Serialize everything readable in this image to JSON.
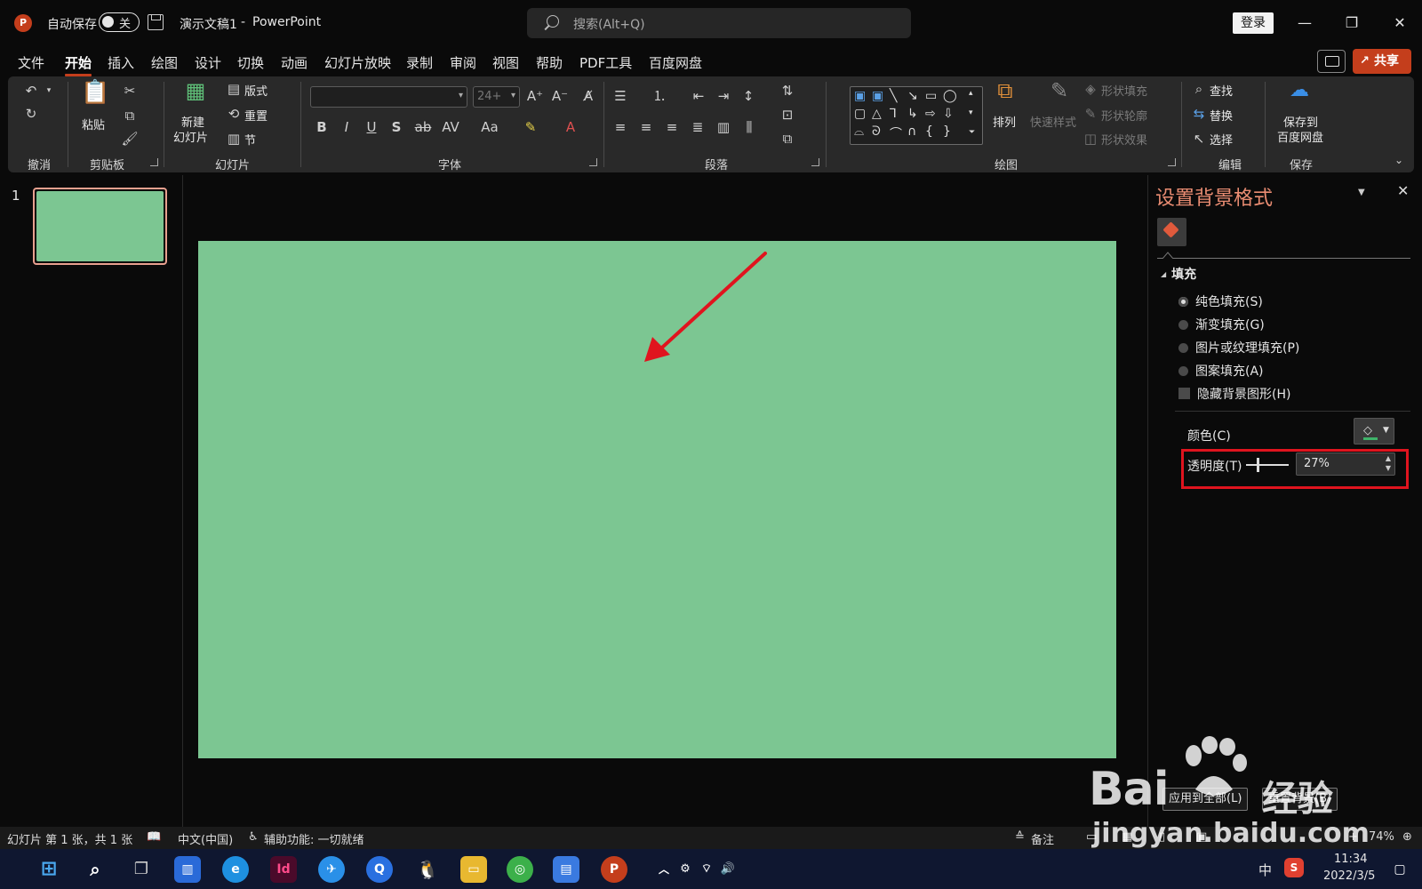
{
  "titlebar": {
    "logo": "P",
    "autosave_label": "自动保存",
    "autosave_state": "关",
    "doc_title": "演示文稿1",
    "separator": "-",
    "app_name": "PowerPoint",
    "search_placeholder": "搜索(Alt+Q)",
    "login": "登录",
    "icons": [
      "powerpoint-logo",
      "save-icon",
      "search-icon",
      "minimize-icon",
      "restore-icon",
      "close-icon"
    ]
  },
  "menu": {
    "tabs": [
      "文件",
      "开始",
      "插入",
      "绘图",
      "设计",
      "切换",
      "动画",
      "幻灯片放映",
      "录制",
      "审阅",
      "视图",
      "帮助",
      "PDF工具",
      "百度网盘"
    ],
    "active": "开始",
    "share": "共享"
  },
  "ribbon": {
    "groups": {
      "undo": "撤消",
      "clipboard": "剪贴板",
      "slides": "幻灯片",
      "font": "字体",
      "paragraph": "段落",
      "drawing": "绘图",
      "editing": "编辑",
      "save": "保存"
    },
    "paste": "粘贴",
    "new_slide_1": "新建",
    "new_slide_2": "幻灯片",
    "layout": "版式",
    "reset": "重置",
    "section": "节",
    "font_name": "",
    "font_size": "24+",
    "arrange": "排列",
    "quick_styles": "快速样式",
    "shape_fill": "形状填充",
    "shape_outline": "形状轮廓",
    "shape_effects": "形状效果",
    "find": "查找",
    "replace": "替换",
    "select": "选择",
    "save_baidu_1": "保存到",
    "save_baidu_2": "百度网盘"
  },
  "thumbnails": [
    {
      "number": "1",
      "color": "#7cc692"
    }
  ],
  "slide": {
    "background": "#7cc692"
  },
  "panel": {
    "title": "设置背景格式",
    "section": "填充",
    "options": [
      {
        "label": "纯色填充(S)",
        "selected": true
      },
      {
        "label": "渐变填充(G)",
        "selected": false
      },
      {
        "label": "图片或纹理填充(P)",
        "selected": false
      },
      {
        "label": "图案填充(A)",
        "selected": false
      }
    ],
    "hide_bg": "隐藏背景图形(H)",
    "color_label": "颜色(C)",
    "transparency_label": "透明度(T)",
    "transparency_value": "27%",
    "transparency_fraction": 0.27,
    "apply_all": "应用到全部(L)",
    "reset_bg": "重置背景(B)"
  },
  "status": {
    "slide_info": "幻灯片 第 1 张，共 1 张",
    "language": "中文(中国)",
    "accessibility": "辅助功能: 一切就绪",
    "notes": "备注",
    "zoom": "74%"
  },
  "taskbar": {
    "ime": "中",
    "time": "11:34",
    "date": "2022/3/5"
  },
  "watermark": {
    "brand": "Bai",
    "jingyan": "经验",
    "url": "jingyan.baidu.com"
  },
  "colors": {
    "accent": "#c43e1c",
    "slide_green": "#7cc692",
    "highlight_red": "#e0141e",
    "panel_title": "#e98c72"
  }
}
